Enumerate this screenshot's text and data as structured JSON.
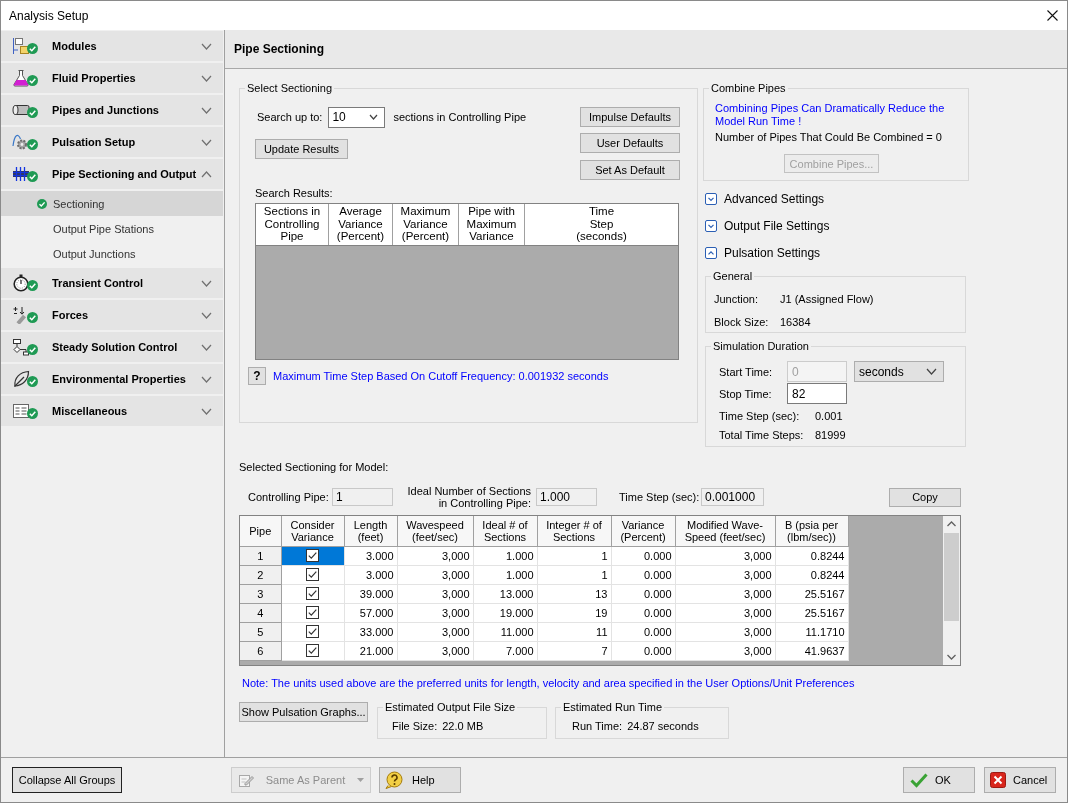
{
  "window": {
    "title": "Analysis Setup"
  },
  "sidebar": {
    "groups": [
      {
        "label": "Modules",
        "complete": true,
        "expanded": false
      },
      {
        "label": "Fluid Properties",
        "complete": true,
        "expanded": false
      },
      {
        "label": "Pipes and Junctions",
        "complete": true,
        "expanded": false
      },
      {
        "label": "Pulsation Setup",
        "complete": true,
        "expanded": false
      },
      {
        "label": "Pipe Sectioning and Output",
        "complete": true,
        "expanded": true,
        "children": [
          {
            "label": "Sectioning",
            "complete": true,
            "selected": true
          },
          {
            "label": "Output Pipe Stations",
            "complete": false,
            "selected": false
          },
          {
            "label": "Output Junctions",
            "complete": false,
            "selected": false
          }
        ]
      },
      {
        "label": "Transient Control",
        "complete": true,
        "expanded": false
      },
      {
        "label": "Forces",
        "complete": true,
        "expanded": false
      },
      {
        "label": "Steady Solution Control",
        "complete": true,
        "expanded": false
      },
      {
        "label": "Environmental Properties",
        "complete": true,
        "expanded": false
      },
      {
        "label": "Miscellaneous",
        "complete": true,
        "expanded": false
      }
    ]
  },
  "panel": {
    "title": "Pipe Sectioning"
  },
  "select_sectioning": {
    "title": "Select Sectioning",
    "search_label": "Search up to:",
    "search_value": "10",
    "search_suffix": "sections in Controlling Pipe",
    "update_button": "Update Results",
    "default_buttons": [
      "Impulse Defaults",
      "User Defaults",
      "Set As Default"
    ],
    "results_label": "Search Results:",
    "results_columns": [
      "Sections in\nControlling\nPipe",
      "Average\nVariance\n(Percent)",
      "Maximum\nVariance\n(Percent)",
      "Pipe with\nMaximum\nVariance",
      "Time\nStep\n(seconds)"
    ],
    "help_button": "?",
    "max_time_step_note": "Maximum Time Step Based On Cutoff Frequency: 0.001932 seconds"
  },
  "combine_pipes": {
    "title": "Combine Pipes",
    "notice": "Combining Pipes Can Dramatically Reduce the\nModel Run Time !",
    "count_text": "Number of Pipes That Could Be Combined = 0",
    "button": {
      "label": "Combine Pipes...",
      "disabled": true
    }
  },
  "settings_sections": [
    {
      "label": "Advanced Settings",
      "expanded": false
    },
    {
      "label": "Output File Settings",
      "expanded": false
    },
    {
      "label": "Pulsation Settings",
      "expanded": true,
      "general": {
        "title": "General",
        "junction_label": "Junction:",
        "junction_value": "J1 (Assigned Flow)",
        "block_size_label": "Block Size:",
        "block_size_value": "16384"
      },
      "simulation_duration": {
        "title": "Simulation Duration",
        "start_time_label": "Start Time:",
        "start_time": {
          "value": "0",
          "disabled": true
        },
        "time_unit": "seconds",
        "stop_time_label": "Stop Time:",
        "stop_time": {
          "value": "82",
          "disabled": false
        },
        "time_step_label": "Time Step (sec):",
        "time_step_value": "0.001",
        "total_steps_label": "Total Time Steps:",
        "total_steps_value": "81999"
      }
    }
  ],
  "selected_sectioning": {
    "title": "Selected Sectioning for Model:",
    "controlling_pipe_label": "Controlling Pipe:",
    "controlling_pipe_value": "1",
    "ideal_sections_label": "Ideal Number of Sections\nin Controlling Pipe:",
    "ideal_sections_value": "1.000",
    "time_step_label": "Time Step (sec):",
    "time_step_value": "0.001000",
    "copy_button": "Copy",
    "table": {
      "columns": [
        "Pipe",
        "Consider\nVariance",
        "Length\n(feet)",
        "Wavespeed\n(feet/sec)",
        "Ideal # of\nSections",
        "Integer # of\nSections",
        "Variance\n(Percent)",
        "Modified Wave-\nSpeed (feet/sec)",
        "B (psia per\n(lbm/sec))"
      ],
      "rows": [
        {
          "pipe": "1",
          "consider_variance": true,
          "selected": true,
          "values": [
            "3.000",
            "3,000",
            "1.000",
            "1",
            "0.000",
            "3,000",
            "0.8244"
          ]
        },
        {
          "pipe": "2",
          "consider_variance": true,
          "selected": false,
          "values": [
            "3.000",
            "3,000",
            "1.000",
            "1",
            "0.000",
            "3,000",
            "0.8244"
          ]
        },
        {
          "pipe": "3",
          "consider_variance": true,
          "selected": false,
          "values": [
            "39.000",
            "3,000",
            "13.000",
            "13",
            "0.000",
            "3,000",
            "25.5167"
          ]
        },
        {
          "pipe": "4",
          "consider_variance": true,
          "selected": false,
          "values": [
            "57.000",
            "3,000",
            "19.000",
            "19",
            "0.000",
            "3,000",
            "25.5167"
          ]
        },
        {
          "pipe": "5",
          "consider_variance": true,
          "selected": false,
          "values": [
            "33.000",
            "3,000",
            "11.000",
            "11",
            "0.000",
            "3,000",
            "11.1710"
          ]
        },
        {
          "pipe": "6",
          "consider_variance": true,
          "selected": false,
          "values": [
            "21.000",
            "3,000",
            "7.000",
            "7",
            "0.000",
            "3,000",
            "41.9637"
          ]
        }
      ]
    }
  },
  "units_note": "Note: The units used above are the preferred units for length, velocity and area specified in the User Options/Unit Preferences",
  "graphs_button": "Show Pulsation Graphs...",
  "estimates": [
    {
      "title": "Estimated Output File Size",
      "label": "File Size:",
      "value": "22.0 MB"
    },
    {
      "title": "Estimated Run Time",
      "label": "Run Time:",
      "value": "24.87 seconds"
    }
  ],
  "footer": {
    "collapse_button": {
      "label": "Collapse All Groups",
      "focused": true
    },
    "inheritance_dropdown": {
      "value": "Same As Parent",
      "disabled": true
    },
    "help_button": "Help",
    "ok_button": "OK",
    "cancel_button": "Cancel"
  }
}
